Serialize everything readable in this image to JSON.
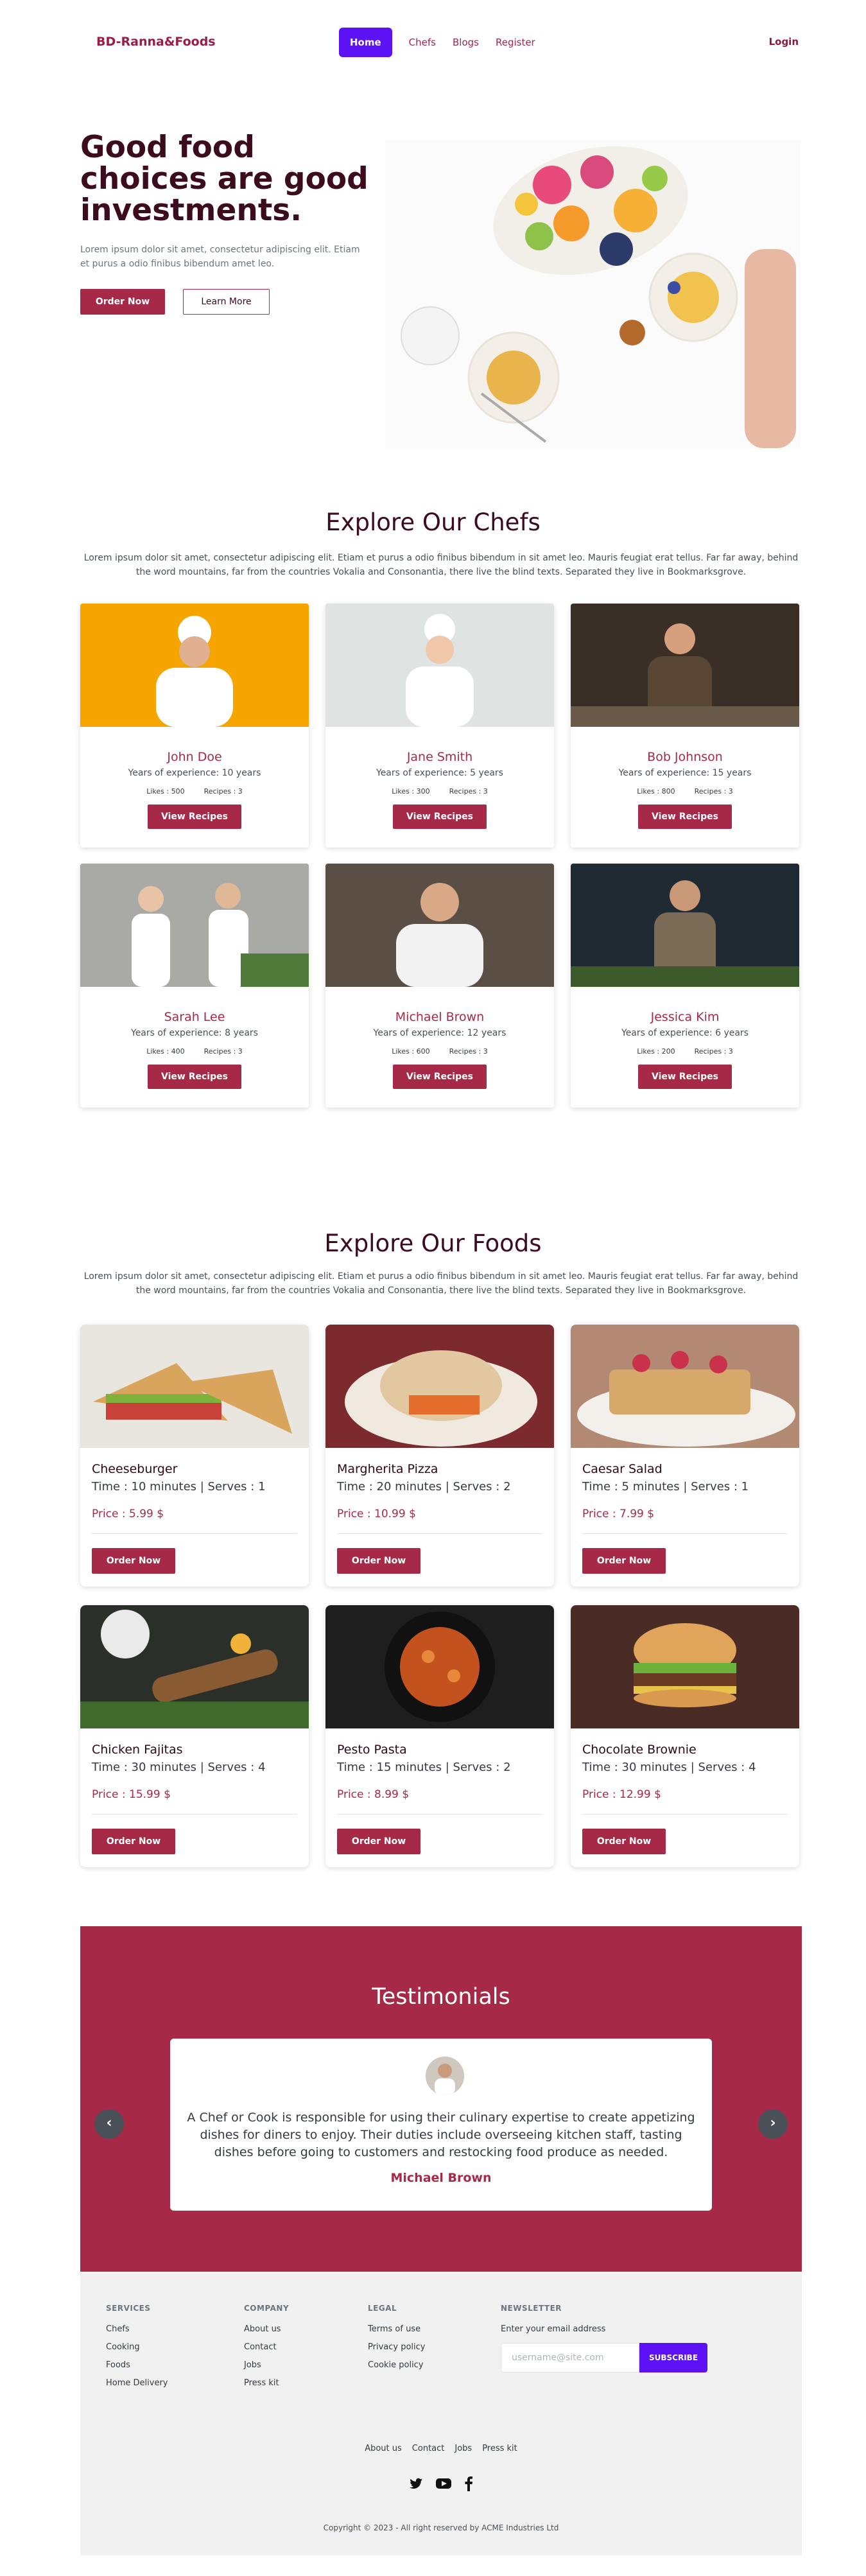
{
  "nav": {
    "brand": "BD-Ranna&Foods",
    "links": [
      "Home",
      "Chefs",
      "Blogs",
      "Register"
    ],
    "login": "Login"
  },
  "hero": {
    "title": "Good food choices are good investments.",
    "text": "Lorem ipsum dolor sit amet, consectetur adipiscing elit. Etiam et purus a odio finibus bibendum amet leo.",
    "order_label": "Order Now",
    "learn_label": "Learn More"
  },
  "chefs_section": {
    "title": "Explore Our Chefs",
    "text": "Lorem ipsum dolor sit amet, consectetur adipiscing elit. Etiam et purus a odio finibus bibendum in sit amet leo. Mauris feugiat erat tellus. Far far away, behind the word mountains, far from the countries Vokalia and Consonantia, there live the blind texts. Separated they live in Bookmarksgrove.",
    "chefs": [
      {
        "name": "John Doe",
        "experience": "Years of experience: 10 years",
        "likes": "Likes : 500",
        "recipes": "Recipes : 3",
        "button": "View Recipes"
      },
      {
        "name": "Jane Smith",
        "experience": "Years of experience: 5 years",
        "likes": "Likes : 300",
        "recipes": "Recipes : 3",
        "button": "View Recipes"
      },
      {
        "name": "Bob Johnson",
        "experience": "Years of experience: 15 years",
        "likes": "Likes : 800",
        "recipes": "Recipes : 3",
        "button": "View Recipes"
      },
      {
        "name": "Sarah Lee",
        "experience": "Years of experience: 8 years",
        "likes": "Likes : 400",
        "recipes": "Recipes : 3",
        "button": "View Recipes"
      },
      {
        "name": "Michael Brown",
        "experience": "Years of experience: 12 years",
        "likes": "Likes : 600",
        "recipes": "Recipes : 3",
        "button": "View Recipes"
      },
      {
        "name": "Jessica Kim",
        "experience": "Years of experience: 6 years",
        "likes": "Likes : 200",
        "recipes": "Recipes : 3",
        "button": "View Recipes"
      }
    ]
  },
  "foods_section": {
    "title": "Explore Our Foods",
    "text": "Lorem ipsum dolor sit amet, consectetur adipiscing elit. Etiam et purus a odio finibus bibendum in sit amet leo. Mauris feugiat erat tellus. Far far away, behind the word mountains, far from the countries Vokalia and Consonantia, there live the blind texts. Separated they live in Bookmarksgrove.",
    "foods": [
      {
        "name": "Cheeseburger",
        "meta": "Time : 10 minutes | Serves : 1",
        "price": "Price : 5.99 $",
        "button": "Order Now"
      },
      {
        "name": "Margherita Pizza",
        "meta": "Time : 20 minutes | Serves : 2",
        "price": "Price : 10.99 $",
        "button": "Order Now"
      },
      {
        "name": "Caesar Salad",
        "meta": "Time : 5 minutes | Serves : 1",
        "price": "Price : 7.99 $",
        "button": "Order Now"
      },
      {
        "name": "Chicken Fajitas",
        "meta": "Time : 30 minutes | Serves : 4",
        "price": "Price : 15.99 $",
        "button": "Order Now"
      },
      {
        "name": "Pesto Pasta",
        "meta": "Time : 15 minutes | Serves : 2",
        "price": "Price : 8.99 $",
        "button": "Order Now"
      },
      {
        "name": "Chocolate Brownie",
        "meta": "Time : 30 minutes | Serves : 4",
        "price": "Price : 12.99 $",
        "button": "Order Now"
      }
    ]
  },
  "testimonials": {
    "title": "Testimonials",
    "quote": "A Chef or Cook is responsible for using their culinary expertise to create appetizing dishes for diners to enjoy. Their duties include overseeing kitchen staff, tasting dishes before going to customers and restocking food produce as needed.",
    "name": "Michael Brown",
    "prev": "‹",
    "next": "›"
  },
  "footer": {
    "services": {
      "heading": "SERVICES",
      "links": [
        "Chefs",
        "Cooking",
        "Foods",
        "Home Delivery"
      ]
    },
    "company": {
      "heading": "COMPANY",
      "links": [
        "About us",
        "Contact",
        "Jobs",
        "Press kit"
      ]
    },
    "legal": {
      "heading": "LEGAL",
      "links": [
        "Terms of use",
        "Privacy policy",
        "Cookie policy"
      ]
    },
    "newsletter": {
      "heading": "NEWSLETTER",
      "label": "Enter your email address",
      "placeholder": "username@site.com",
      "button": "SUBSCRIBE"
    },
    "bottom_links": [
      "About us",
      "Contact",
      "Jobs",
      "Press kit"
    ],
    "social_icons": [
      "twitter-icon",
      "youtube-icon",
      "facebook-icon"
    ],
    "copyright": "Copyright © 2023 - All right reserved by ACME Industries Ltd"
  },
  "colors": {
    "brand": "#a62a48",
    "accent": "#5c12f5",
    "dark": "#3c0b1c"
  }
}
